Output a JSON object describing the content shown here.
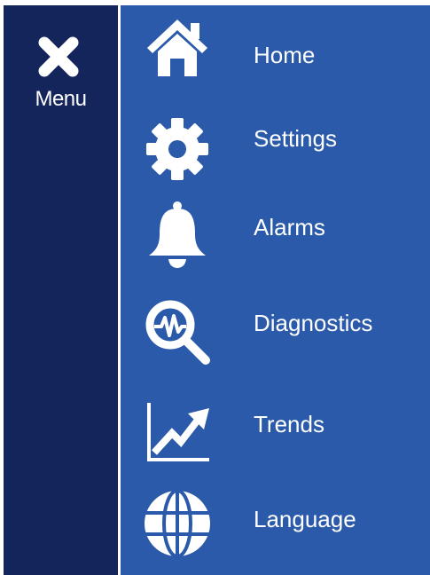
{
  "menu": {
    "toggle_label": "Menu",
    "toggle_icon": "close-icon"
  },
  "nav": {
    "items": [
      {
        "label": "Home",
        "icon": "home-icon"
      },
      {
        "label": "Settings",
        "icon": "gear-icon"
      },
      {
        "label": "Alarms",
        "icon": "bell-icon"
      },
      {
        "label": "Diagnostics",
        "icon": "diagnostics-magnifier-icon"
      },
      {
        "label": "Trends",
        "icon": "trend-chart-icon"
      },
      {
        "label": "Language",
        "icon": "globe-icon"
      }
    ]
  },
  "colors": {
    "rail_background": "#13255a",
    "panel_background": "#2a5aa9",
    "foreground": "#ffffff"
  }
}
